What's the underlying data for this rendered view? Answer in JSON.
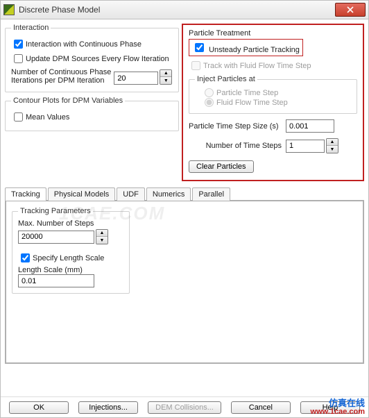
{
  "window": {
    "title": "Discrete Phase Model"
  },
  "interaction": {
    "legend": "Interaction",
    "continuous_label": "Interaction with Continuous Phase",
    "continuous_checked": true,
    "update_label": "Update DPM Sources Every Flow Iteration",
    "update_checked": false,
    "ncont_label_l1": "Number of Continuous Phase",
    "ncont_label_l2": "Iterations per DPM Iteration",
    "ncont_value": "20"
  },
  "contour": {
    "legend": "Contour Plots for DPM Variables",
    "mean_label": "Mean Values",
    "mean_checked": false
  },
  "particle": {
    "legend": "Particle Treatment",
    "unsteady_label": "Unsteady Particle Tracking",
    "unsteady_checked": true,
    "trackfft_label": "Track with Fluid Flow Time Step",
    "trackfft_checked": false,
    "inject_legend": "Inject Particles at",
    "radio_particle": "Particle Time Step",
    "radio_fluid": "Fluid Flow Time Step",
    "ptss_label": "Particle Time Step Size (s)",
    "ptss_value": "0.001",
    "nts_label": "Number of Time Steps",
    "nts_value": "1",
    "clear_label": "Clear Particles"
  },
  "tabs": {
    "tracking": "Tracking",
    "physical": "Physical Models",
    "udf": "UDF",
    "numerics": "Numerics",
    "parallel": "Parallel"
  },
  "tracking": {
    "legend": "Tracking Parameters",
    "maxsteps_label": "Max. Number of Steps",
    "maxsteps_value": "20000",
    "specify_label": "Specify Length Scale",
    "specify_checked": true,
    "lenscale_label": "Length Scale (mm)",
    "lenscale_value": "0.01"
  },
  "buttons": {
    "ok": "OK",
    "injections": "Injections...",
    "dem": "DEM Collisions...",
    "cancel": "Cancel",
    "help": "Help"
  },
  "watermark": "1CAE.COM",
  "overlay": {
    "cn": "仿真在线",
    "url": "www.1cae.com"
  }
}
